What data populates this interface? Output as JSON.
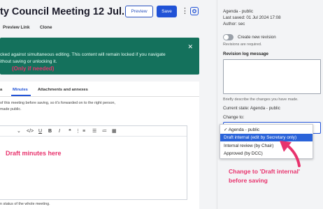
{
  "header": {
    "title": "ty Council Meeting 12 Jul...",
    "preview_label": "Preview",
    "save_label": "Save"
  },
  "subtabs": [
    "Preview Link",
    "Clone"
  ],
  "alert": {
    "line1": "cked against simultaneous editing. This content will remain locked if you navigate",
    "line2": "ithout saving or unlocking it."
  },
  "content_tabs": [
    "a",
    "Minutes",
    "Attachments and annexes"
  ],
  "help": {
    "line1": "of this meeting before saving, so it's forwarded on to the right person,",
    "line2": "made public."
  },
  "editor": {
    "draft_note": "Draft minutes here"
  },
  "footer_text": "n status of the whole meeting.",
  "sidebar": {
    "current_state_header": "Agenda - public",
    "last_saved": "Last saved: 01 Jul 2024 17:08",
    "author": "Author: sec",
    "create_revision": "Create new revision",
    "revisions_required": "Revisions are required.",
    "revision_log_label": "Revision log message",
    "revision_note": "(Only if needed)",
    "revision_help": "Briefly describe the changes you have made.",
    "current_state": "Current state: Agenda - public",
    "change_to_label": "Change to:",
    "change_note_line1": "Change to 'Draft internal'",
    "change_note_line2": "before saving"
  },
  "dropdown_options": [
    "✓ Agenda - public",
    "Draft internal (edit by Secretary only)",
    "Internal review (by Chair)",
    "Approved (by DCC)"
  ],
  "colors": {
    "accent": "#2052d6",
    "alert_bg": "#14715c",
    "annotation": "#e8336d"
  }
}
